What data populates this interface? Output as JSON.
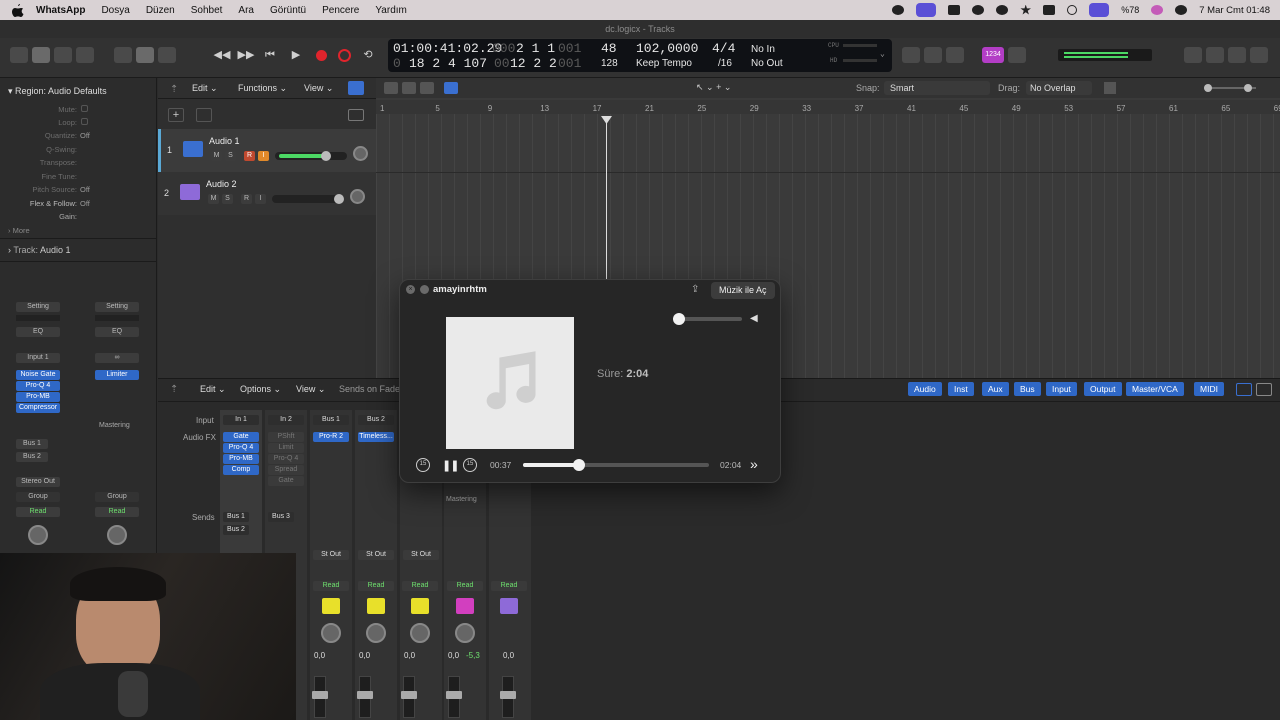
{
  "menubar": {
    "app": "WhatsApp",
    "items": [
      "Dosya",
      "Düzen",
      "Sohbet",
      "Ara",
      "Görüntü",
      "Pencere",
      "Yardım"
    ],
    "battery": "%78",
    "datetime": "7 Mar Cmt  01:48"
  },
  "window": {
    "title": "dc.logicx - Tracks"
  },
  "lcd": {
    "smpte": "01:00:41:02.29",
    "bars_top_dim": "000",
    "bars_top": "2 1 1",
    "bars_top_end": "001",
    "bars_bot_dim": "0",
    "bars_bot": "18 2 4 107",
    "bars_bot_r_dim": "00",
    "bars_bot_r": "12 2 2",
    "bars_bot_end": "001",
    "bpm_top": "48",
    "bpm_bot": "128",
    "division_top": "102,0000",
    "division_bot": "Keep Tempo",
    "sig_top": "4/4",
    "sig_bot": "/16",
    "in": "No In",
    "out": "No Out",
    "cpu": "CPU",
    "hd": "HD"
  },
  "toolbar": {
    "badge": "1234"
  },
  "inspector": {
    "region_title": "Region: Audio Defaults",
    "rows": [
      {
        "k": "Mute:",
        "v": ""
      },
      {
        "k": "Loop:",
        "v": ""
      },
      {
        "k": "Quantize:",
        "v": "Off"
      },
      {
        "k": "Q-Swing:",
        "v": ""
      },
      {
        "k": "Transpose:",
        "v": ""
      },
      {
        "k": "Fine Tune:",
        "v": ""
      },
      {
        "k": "Pitch Source:",
        "v": "Off"
      },
      {
        "k": "Flex & Follow:",
        "v": "Off"
      },
      {
        "k": "Gain:",
        "v": ""
      }
    ],
    "more": "More",
    "track_title": "Track:",
    "track_name": "Audio 1",
    "strip1": {
      "setting": "Setting",
      "eq": "EQ",
      "input": "Input 1",
      "plugins": [
        "Noise Gate",
        "Pro-Q 4",
        "Pro-MB",
        "Compressor"
      ],
      "sends": [
        "Bus 1",
        "Bus 2"
      ],
      "output": "Stereo Out",
      "group": "Group",
      "read": "Read"
    },
    "strip2": {
      "setting": "Setting",
      "eq": "EQ",
      "plugins": [
        "Limiter"
      ],
      "name": "Mastering",
      "group": "Group",
      "read": "Read"
    }
  },
  "tracks_header": {
    "edit": "Edit",
    "functions": "Functions",
    "view": "View",
    "snap_label": "Snap:",
    "snap": "Smart",
    "drag_label": "Drag:",
    "drag": "No Overlap"
  },
  "tracks": [
    {
      "num": "1",
      "name": "Audio 1",
      "m": "M",
      "s": "S",
      "r": "R",
      "i": "I"
    },
    {
      "num": "2",
      "name": "Audio 2",
      "m": "M",
      "s": "S",
      "r": "R",
      "i": "I"
    }
  ],
  "ruler": [
    "1",
    "5",
    "9",
    "13",
    "17",
    "21",
    "25",
    "29",
    "33",
    "37",
    "41",
    "45",
    "49",
    "53",
    "57",
    "61",
    "65",
    "69"
  ],
  "mixer": {
    "edit": "Edit",
    "options": "Options",
    "view": "View",
    "sends_on": "Sends on Fade",
    "tabs": [
      "Audio",
      "Inst",
      "Aux",
      "Bus",
      "Input",
      "Output",
      "Master/VCA",
      "MIDI"
    ],
    "input_label": "Input",
    "fx_label": "Audio FX",
    "sends_label": "Sends",
    "channels": [
      {
        "input": "In 1",
        "fx": [
          "Gate",
          "Pro-Q 4",
          "Pro-MB",
          "Comp"
        ],
        "sends": [
          "Bus 1",
          "Bus 2"
        ]
      },
      {
        "input": "In 2",
        "fx": [
          "PShft",
          "Limit",
          "Pro-Q 4",
          "Spread",
          "Gate"
        ],
        "sends": [
          "Bus 3"
        ]
      },
      {
        "input": "Bus 1",
        "fx": [
          "Pro-R 2"
        ],
        "out": "St Out"
      },
      {
        "input": "Bus 2",
        "fx": [
          "Timeless..."
        ],
        "out": "St Out"
      },
      {
        "out": "St Out"
      }
    ],
    "mastering": "Mastering",
    "read": "Read",
    "vals": [
      "0,0",
      "0,0",
      "0,0",
      "0,0",
      "0,0",
      "-5,3",
      "0,0"
    ]
  },
  "player": {
    "title": "amayinrhtm",
    "open_with": "Müzik ile Aç",
    "duration_label": "Süre:",
    "duration": "2:04",
    "elapsed": "00:37",
    "total": "02:04",
    "progress": 0.3,
    "volume": 0.05
  }
}
